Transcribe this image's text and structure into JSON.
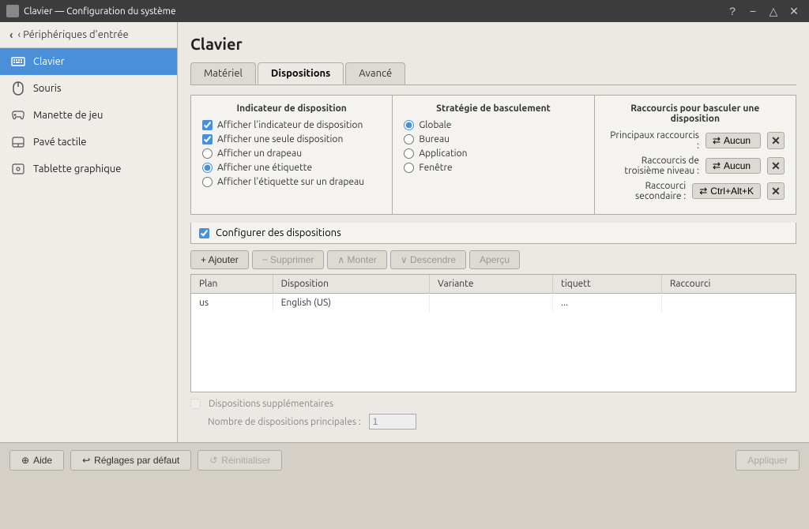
{
  "titlebar": {
    "title": "Clavier — Configuration du système",
    "help_btn": "?",
    "min_btn": "−",
    "max_btn": "△",
    "close_btn": "✕"
  },
  "sidebar": {
    "back_label": "‹ Périphériques d'entrée",
    "items": [
      {
        "id": "clavier",
        "label": "Clavier",
        "icon": "keyboard",
        "active": true
      },
      {
        "id": "souris",
        "label": "Souris",
        "icon": "mouse",
        "active": false
      },
      {
        "id": "manette",
        "label": "Manette de jeu",
        "icon": "gamepad",
        "active": false
      },
      {
        "id": "pave",
        "label": "Pavé tactile",
        "icon": "touchpad",
        "active": false
      },
      {
        "id": "tablette",
        "label": "Tablette graphique",
        "icon": "tablet",
        "active": false
      }
    ]
  },
  "panel": {
    "title": "Clavier",
    "tabs": [
      {
        "id": "materiel",
        "label": "Matériel"
      },
      {
        "id": "dispositions",
        "label": "Dispositions",
        "active": true
      },
      {
        "id": "avance",
        "label": "Avancé"
      }
    ],
    "indicator_section": {
      "title": "Indicateur de disposition",
      "options": [
        {
          "id": "afficher-indicateur",
          "label": "Afficher l'indicateur de disposition",
          "type": "checkbox",
          "checked": true
        },
        {
          "id": "afficher-seule",
          "label": "Afficher une seule disposition",
          "type": "checkbox",
          "checked": true
        },
        {
          "id": "afficher-drapeau",
          "label": "Afficher un drapeau",
          "type": "radio",
          "checked": false
        },
        {
          "id": "afficher-etiquette",
          "label": "Afficher une étiquette",
          "type": "radio",
          "checked": true
        },
        {
          "id": "afficher-etiquette-drapeau",
          "label": "Afficher l'étiquette sur un drapeau",
          "type": "radio",
          "checked": false
        }
      ]
    },
    "strategy_section": {
      "title": "Stratégie de basculement",
      "options": [
        {
          "id": "globale",
          "label": "Globale",
          "checked": true
        },
        {
          "id": "bureau",
          "label": "Bureau",
          "checked": false
        },
        {
          "id": "application",
          "label": "Application",
          "checked": false
        },
        {
          "id": "fenetre",
          "label": "Fenêtre",
          "checked": false
        }
      ]
    },
    "shortcuts_section": {
      "title": "Raccourcis pour basculer une disposition",
      "rows": [
        {
          "id": "principaux",
          "label": "Principaux raccourcis :",
          "value": "Aucun",
          "icon": "⇄"
        },
        {
          "id": "troisieme",
          "label": "Raccourcis de troisième niveau :",
          "value": "Aucun",
          "icon": "⇄"
        },
        {
          "id": "secondaire",
          "label": "Raccourci secondaire :",
          "value": "Ctrl+Alt+K",
          "icon": "⇄"
        }
      ]
    },
    "configure_label": "Configurer des dispositions",
    "toolbar": {
      "add": "+ Ajouter",
      "remove": "− Supprimer",
      "up": "∧ Monter",
      "down": "∨ Descendre",
      "preview": "Aperçu"
    },
    "table": {
      "columns": [
        "Plan",
        "Disposition",
        "Variante",
        "tiquett",
        "Raccourci"
      ],
      "rows": [
        {
          "plan": "us",
          "disposition": "English (US)",
          "variante": "",
          "tiquett": "...",
          "raccourci": ""
        }
      ]
    },
    "dispositions_sup_label": "Dispositions supplémentaires",
    "nombre_label": "Nombre de dispositions principales :",
    "bottom_buttons": {
      "aide": "Aide",
      "aide_icon": "⊕",
      "reglages": "Réglages par défaut",
      "reglages_icon": "↩",
      "reinitialiser": "Réinitialiser",
      "reinitialiser_icon": "↺",
      "appliquer": "Appliquer"
    }
  }
}
